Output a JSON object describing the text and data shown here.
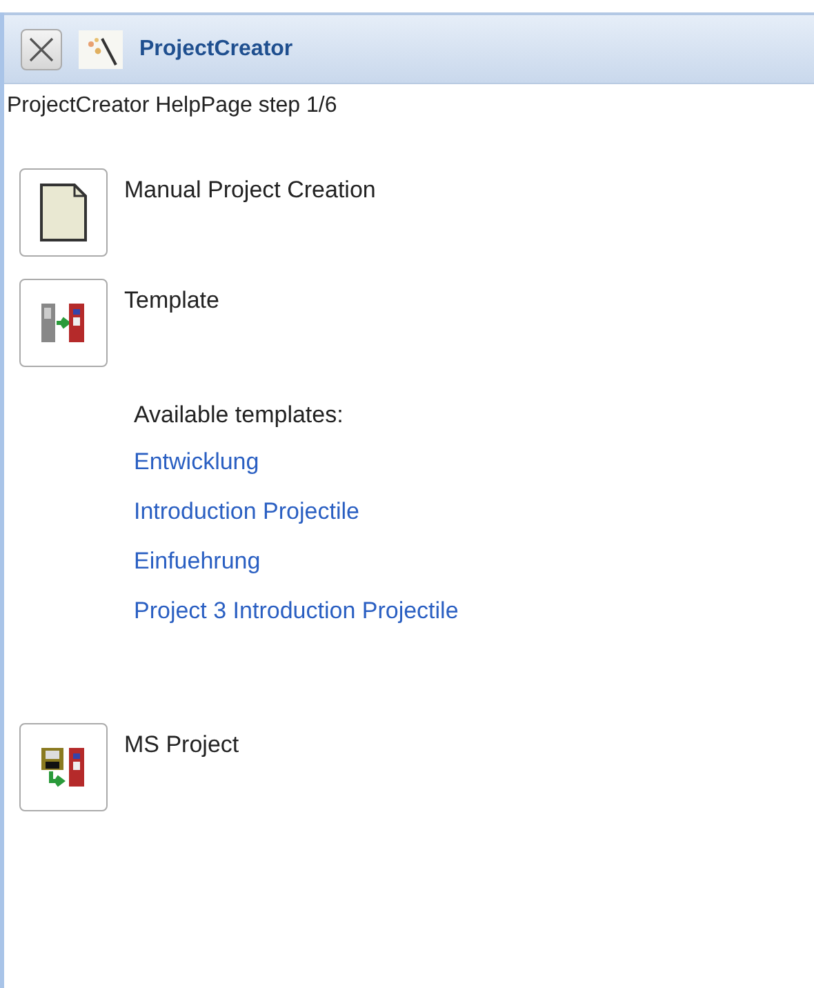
{
  "window": {
    "title": "ProjectCreator"
  },
  "help_text": "ProjectCreator HelpPage step 1/6",
  "options": [
    {
      "kind": "manual",
      "label": "Manual Project Creation"
    },
    {
      "kind": "template",
      "label": "Template",
      "templates_heading": "Available templates:",
      "templates": [
        "Entwicklung",
        "Introduction Projectile",
        "Einfuehrung",
        "Project 3 Introduction Projectile"
      ]
    },
    {
      "kind": "msproject",
      "label": "MS Project"
    }
  ]
}
